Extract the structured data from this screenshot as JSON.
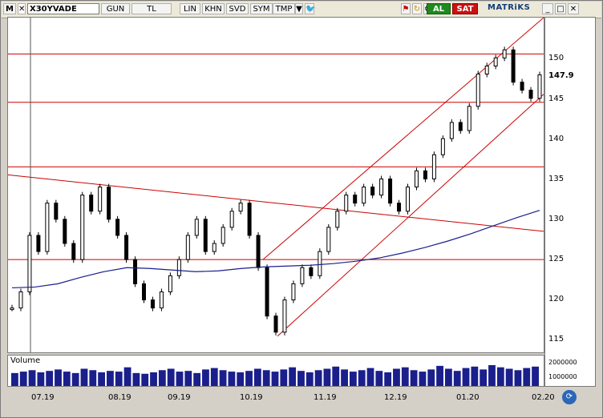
{
  "toolbar": {
    "menu_label": "M",
    "symbol": "X30YVADE",
    "period_label": "GUN",
    "currency_label": "TL",
    "scale_buttons": [
      "LIN",
      "KHN",
      "SVD",
      "SYM",
      "TMP"
    ],
    "buy_label": "AL",
    "sell_label": "SAT",
    "brand": "MATRiKS"
  },
  "colors": {
    "price_line": "#000000",
    "trend_line": "#cc0000",
    "ma_line": "#1a1f8c",
    "volume": "#1a1f8c",
    "buy": "#1f8a1f",
    "sell": "#cc1111"
  },
  "chart_data": {
    "type": "line",
    "title": "",
    "y_ticks": [
      "150",
      "147.9",
      "145",
      "140",
      "135",
      "130",
      "125",
      "120",
      "115"
    ],
    "x_ticks": [
      "07.19",
      "08.19",
      "09.19",
      "10.19",
      "11.19",
      "12.19",
      "01.20",
      "02.20"
    ],
    "last_price": 147.9,
    "ylim": [
      113.5,
      155
    ],
    "horizontal_levels": [
      150.5,
      144.5,
      136.5,
      125
    ],
    "price_series": [
      119,
      121,
      128,
      126,
      132,
      130,
      127,
      125,
      133,
      131,
      134,
      130,
      128,
      125,
      122,
      120,
      119,
      121,
      123,
      125,
      128,
      130,
      126,
      127,
      129,
      131,
      132,
      128,
      124,
      118,
      116,
      120,
      122,
      124,
      123,
      126,
      129,
      131,
      133,
      132,
      134,
      133,
      135,
      132,
      131,
      134,
      136,
      135,
      138,
      140,
      142,
      141,
      144,
      148,
      149,
      150,
      151,
      147,
      146,
      145,
      147.9
    ],
    "ma_series": [
      121.5,
      121.6,
      122,
      122.8,
      123.5,
      124,
      123.9,
      123.7,
      123.5,
      123.6,
      123.9,
      124.1,
      124.2,
      124.3,
      124.5,
      124.8,
      125.2,
      125.8,
      126.5,
      127.3,
      128.2,
      129.2,
      130.2,
      131.1
    ],
    "volume_label": "Volume",
    "volume_ticks": [
      "2000000",
      "1000000"
    ],
    "volume": [
      18,
      20,
      22,
      19,
      21,
      23,
      20,
      18,
      24,
      22,
      19,
      21,
      20,
      26,
      18,
      17,
      19,
      22,
      24,
      20,
      21,
      18,
      23,
      25,
      22,
      20,
      19,
      21,
      24,
      22,
      20,
      23,
      26,
      21,
      19,
      22,
      24,
      27,
      23,
      20,
      22,
      25,
      21,
      19,
      24,
      26,
      22,
      20,
      23,
      28,
      24,
      21,
      25,
      27,
      23,
      29,
      26,
      24,
      22,
      25,
      27
    ]
  }
}
